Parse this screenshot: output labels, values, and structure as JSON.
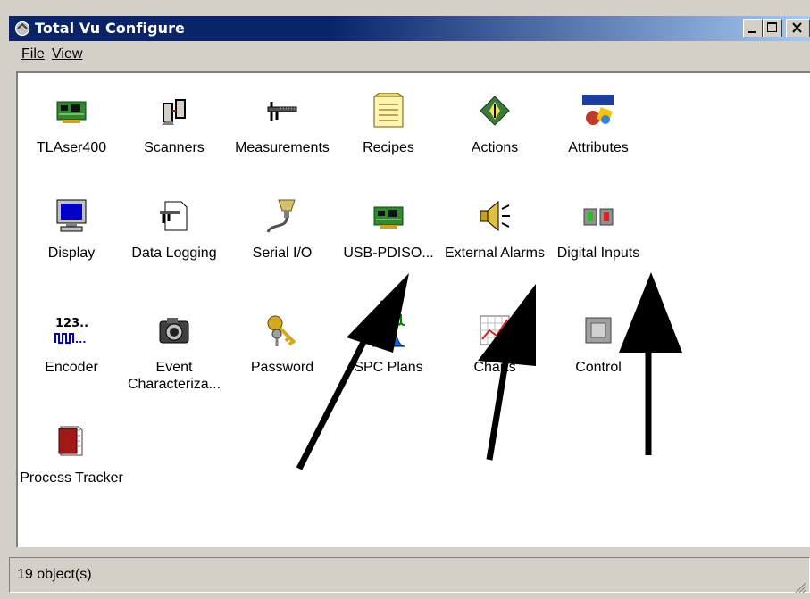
{
  "window": {
    "title": "Total Vu Configure",
    "title_bar_color": "#0a246a",
    "controls": [
      "minimize",
      "maximize",
      "close"
    ]
  },
  "menu": {
    "file": "File",
    "view": "View"
  },
  "items": [
    {
      "label": "TLAser400",
      "icon": "circuit-board-icon"
    },
    {
      "label": "Scanners",
      "icon": "scanner-icon"
    },
    {
      "label": "Measurements",
      "icon": "caliper-icon"
    },
    {
      "label": "Recipes",
      "icon": "recipe-card-icon"
    },
    {
      "label": "Actions",
      "icon": "actions-diamond-icon"
    },
    {
      "label": "Attributes",
      "icon": "attributes-icon"
    },
    {
      "label": "Display",
      "icon": "monitor-icon"
    },
    {
      "label": "Data Logging",
      "icon": "data-logging-icon"
    },
    {
      "label": "Serial I/O",
      "icon": "serial-connector-icon"
    },
    {
      "label": "USB-PDISO...",
      "icon": "circuit-board-icon"
    },
    {
      "label": "External Alarms",
      "icon": "speaker-alarm-icon"
    },
    {
      "label": "Digital Inputs",
      "icon": "digital-inputs-icon"
    },
    {
      "label": "Encoder",
      "icon": "encoder-pulse-icon"
    },
    {
      "label": "Event Characteriza...",
      "icon": "camera-icon"
    },
    {
      "label": "Password",
      "icon": "keys-icon"
    },
    {
      "label": "SPC Plans",
      "icon": "bell-curve-icon"
    },
    {
      "label": "Charts",
      "icon": "chart-grid-icon"
    },
    {
      "label": "Control",
      "icon": "control-icon"
    },
    {
      "label": "Process Tracker",
      "icon": "book-icon"
    }
  ],
  "status": {
    "text": "19 object(s)"
  }
}
